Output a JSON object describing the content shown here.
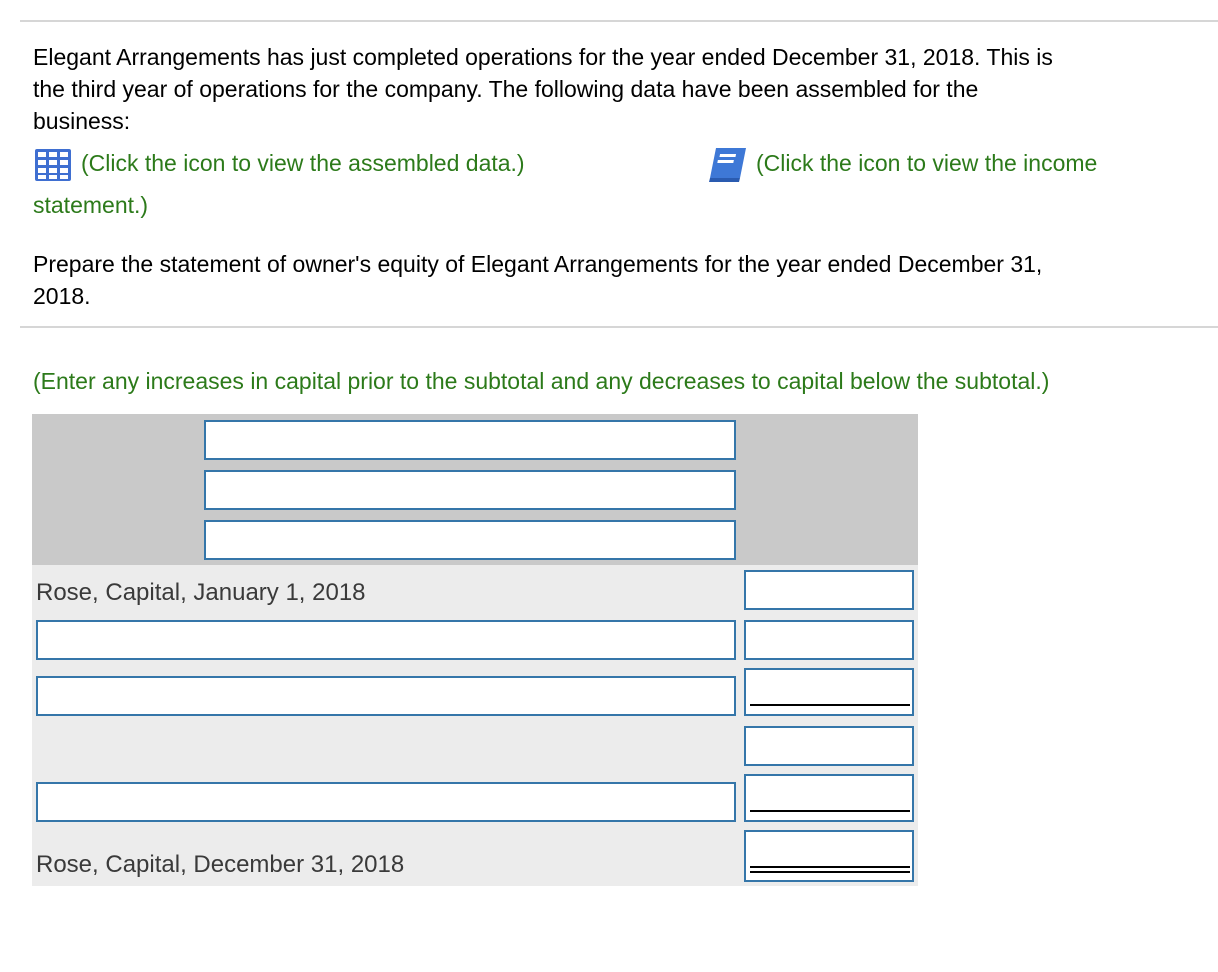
{
  "problem": {
    "intro": [
      "Elegant Arrangements has just completed operations for the year ended December 31, 2018. This is",
      "the third year of operations for the company. The following data have been assembled for the",
      "business:"
    ],
    "link_data": "(Click the icon to view the assembled data.)",
    "link_income_line1": "(Click the icon to view the income",
    "link_income_line2": "statement.)",
    "task": [
      "Prepare the statement of owner's equity of Elegant Arrangements for the year ended December 31,",
      "2018."
    ],
    "instruction": "(Enter any increases in capital prior to the subtotal and any decreases to capital below the subtotal.)"
  },
  "icons": {
    "data_icon": "spreadsheet-grid-icon",
    "income_icon": "book-icon",
    "accent_blue": "#3576a9",
    "link_green": "#2c7a1a"
  },
  "statement": {
    "header_inputs": [
      "",
      "",
      ""
    ],
    "row_beginning_label": "Rose, Capital, January 1, 2018",
    "row_beginning_value": "",
    "row_increase_1": {
      "label": "",
      "value": ""
    },
    "row_increase_2": {
      "label": "",
      "value": ""
    },
    "subtotal_value": "",
    "row_decrease_1": {
      "label": "",
      "value": ""
    },
    "row_ending_label": "Rose, Capital, December 31, 2018",
    "row_ending_value": ""
  }
}
